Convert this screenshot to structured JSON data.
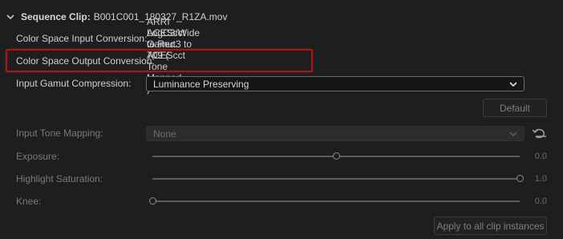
{
  "header": {
    "prefix": "Sequence Clip:",
    "clip_name": "B001C001_180327_R1ZA.mov"
  },
  "fields": {
    "input_conversion": {
      "label": "Color Space Input Conversion:",
      "value": "ARRI LogC3/Wide Gamut3 to ACEScct"
    },
    "output_conversion": {
      "label": "Color Space Output Conversion:",
      "value": "ACEScct to Rec. 709 ( Tone Mapped )"
    },
    "gamut_compression": {
      "label": "Input Gamut Compression:",
      "value": "Luminance Preserving"
    },
    "tone_mapping": {
      "label": "Input Tone Mapping:",
      "value": "None"
    }
  },
  "buttons": {
    "default_label": "Default",
    "apply_all_label": "Apply to all clip instances"
  },
  "sliders": [
    {
      "label": "Exposure:",
      "value": "0.0",
      "position": 0.5
    },
    {
      "label": "Highlight Saturation:",
      "value": "1.0",
      "position": 1.0
    },
    {
      "label": "Knee:",
      "value": "0.0",
      "position": 0.0
    }
  ],
  "colors": {
    "background": "#1e1e1e",
    "highlight_border": "#a31a1a"
  },
  "icons": {
    "collapse": "chevron-down-icon",
    "dropdown": "chevron-down-icon",
    "reset": "reset-icon"
  }
}
